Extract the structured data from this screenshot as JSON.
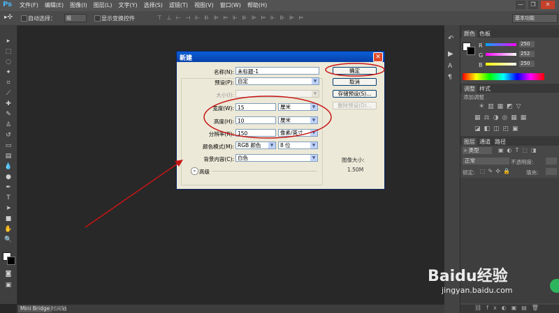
{
  "app": {
    "logo": "Ps"
  },
  "menu": [
    "文件(F)",
    "编辑(E)",
    "图像(I)",
    "图层(L)",
    "文字(Y)",
    "选择(S)",
    "滤镜(T)",
    "视图(V)",
    "窗口(W)",
    "帮助(H)"
  ],
  "window_controls": {
    "minimize": "—",
    "restore": "❐",
    "close": "✕"
  },
  "options_bar": {
    "auto_select_label": "自动选择：",
    "auto_select_value": "组",
    "show_transform_label": "显示变换控件",
    "workspace": "基本功能"
  },
  "dialog": {
    "title": "新建",
    "close": "✕",
    "name_label": "名称(N):",
    "name_value": "未标题-1",
    "preset_label": "预设(P):",
    "preset_value": "自定",
    "size_label": "大小(I):",
    "width_label": "宽度(W):",
    "width_value": "15",
    "width_unit": "厘米",
    "height_label": "高度(H):",
    "height_value": "10",
    "height_unit": "厘米",
    "resolution_label": "分辨率(R):",
    "resolution_value": "150",
    "resolution_unit": "像素/英寸",
    "color_mode_label": "颜色模式(M):",
    "color_mode_value": "RGB 颜色",
    "bit_depth": "8 位",
    "background_label": "背景内容(C):",
    "background_value": "白色",
    "advanced": "高级",
    "image_size_label": "图像大小:",
    "image_size_value": "1.50M",
    "ok": "确定",
    "cancel": "取消",
    "save_preset": "存储预设(S)...",
    "delete_preset": "删除预设(D)..."
  },
  "color_panel": {
    "tabs": [
      "颜色",
      "色板"
    ],
    "channels": [
      {
        "name": "R",
        "value": "250"
      },
      {
        "name": "G",
        "value": "252"
      },
      {
        "name": "B",
        "value": "250"
      }
    ]
  },
  "adjust_panel": {
    "tabs": [
      "调整",
      "样式"
    ],
    "hint": "添加调整"
  },
  "layers_panel": {
    "tabs": [
      "图层",
      "通道",
      "路径"
    ],
    "kind": "类型",
    "blend": "正常",
    "opacity_label": "不透明度:",
    "lock_label": "锁定:",
    "fill_label": "填充:"
  },
  "bottom_tabs": [
    "Mini Bridge",
    "时间轴"
  ],
  "watermark": {
    "text": "Baidu经验",
    "url": "jingyan.baidu.com"
  },
  "colors": {
    "annotation": "#c81414",
    "dialog_bg": "#ece9d8",
    "title_bar": "#0a5fd8"
  }
}
